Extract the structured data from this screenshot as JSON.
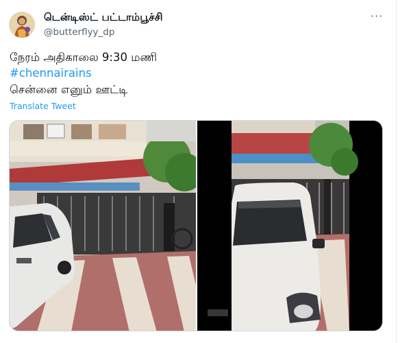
{
  "tweet": {
    "author": {
      "display_name": "டென்டிஸ்ட் பட்டாம்பூச்சி",
      "handle": "@butterflyy_dp",
      "avatar_icon": "user-avatar-icon"
    },
    "more_icon": "more-options-icon",
    "more_label": "···",
    "text_lines": [
      "நேரம் அதிகாலை 9:30 மணி",
      "#chennairains",
      "சென்னை எனும் ஊட்டி"
    ],
    "translate_label": "Translate Tweet",
    "media": [
      {
        "id": "photo-1",
        "description_icon": "photo-street-car-icon"
      },
      {
        "id": "photo-2",
        "description_icon": "photo-parked-car-icon"
      }
    ],
    "colors": {
      "accent": "#1d9bf0",
      "text": "#0f1419",
      "muted": "#536471"
    }
  }
}
